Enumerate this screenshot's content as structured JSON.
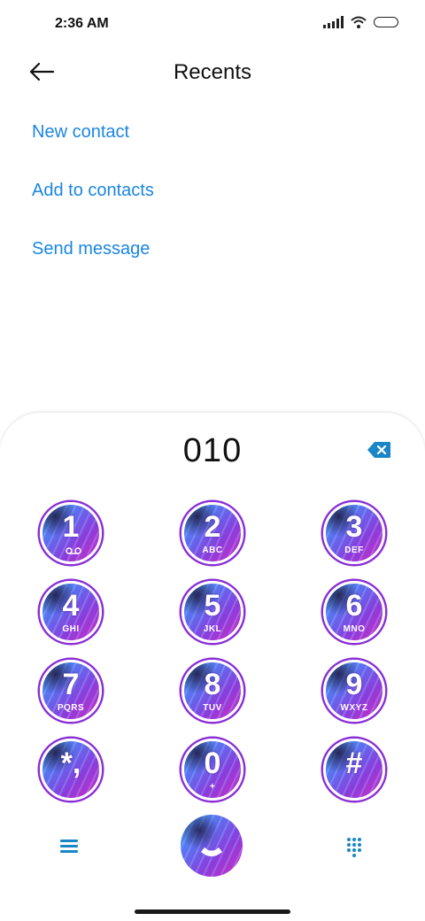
{
  "status_bar": {
    "time": "2:36 AM"
  },
  "header": {
    "title": "Recents",
    "back_icon": "arrow-left-icon"
  },
  "actions": [
    {
      "label": "New contact"
    },
    {
      "label": "Add to contacts"
    },
    {
      "label": "Send message"
    }
  ],
  "dialer": {
    "number": "010",
    "backspace_icon": "backspace-icon",
    "keys": [
      {
        "digit": "1",
        "letters": "",
        "icon": "voicemail-icon"
      },
      {
        "digit": "2",
        "letters": "ABC"
      },
      {
        "digit": "3",
        "letters": "DEF"
      },
      {
        "digit": "4",
        "letters": "GHI"
      },
      {
        "digit": "5",
        "letters": "JKL"
      },
      {
        "digit": "6",
        "letters": "MNO"
      },
      {
        "digit": "7",
        "letters": "PQRS"
      },
      {
        "digit": "8",
        "letters": "TUV"
      },
      {
        "digit": "9",
        "letters": "WXYZ"
      },
      {
        "digit": "*,",
        "letters": ""
      },
      {
        "digit": "0",
        "letters": "+"
      },
      {
        "digit": "#",
        "letters": ""
      }
    ],
    "menu_icon": "hamburger-menu-icon",
    "call_icon": "phone-icon",
    "dialpad_icon": "dialpad-icon"
  },
  "colors": {
    "link": "#1b86e0",
    "accent": "#1a86c8",
    "key_gradient": [
      "#3aa8f0",
      "#8b3bdc",
      "#d12fc4"
    ]
  }
}
